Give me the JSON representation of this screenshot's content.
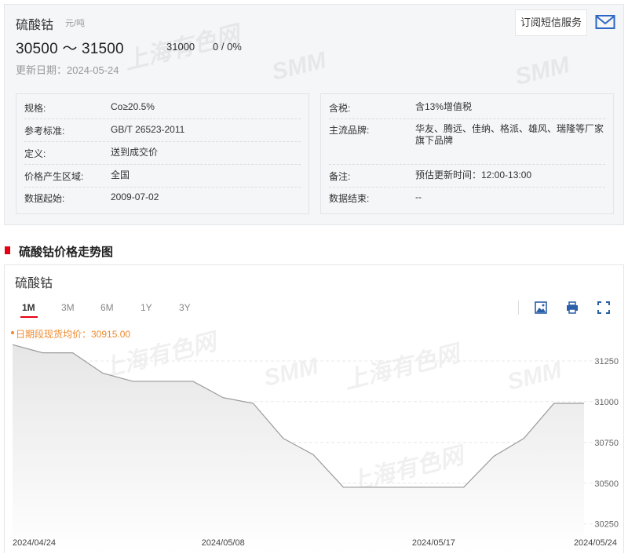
{
  "product": {
    "name": "硫酸钴",
    "unit": "元/吨",
    "price_range": "30500 ～ 31500",
    "avg_price": "31000",
    "change": "0 / 0%",
    "update_date": "更新日期：2024-05-24"
  },
  "actions": {
    "sms_subscribe": "订阅短信服务"
  },
  "specs_left": [
    {
      "label": "规格:",
      "value": "Co≥20.5%"
    },
    {
      "label": "参考标准:",
      "value": "GB/T 26523-2011"
    },
    {
      "label": "定义:",
      "value": "送到成交价"
    },
    {
      "label": "价格产生区域:",
      "value": "全国"
    },
    {
      "label": "数据起始:",
      "value": "2009-07-02"
    }
  ],
  "specs_right": [
    {
      "label": "含税:",
      "value": "含13%增值税"
    },
    {
      "label": "主流品牌:",
      "value": "华友、腾远、佳纳、格派、雄风、瑞隆等厂家旗下品牌"
    },
    {
      "label": "备注:",
      "value": "预估更新时间：12:00-13:00"
    },
    {
      "label": "数据结束:",
      "value": "--"
    }
  ],
  "section": {
    "title": "硫酸钴价格走势图"
  },
  "chart_panel": {
    "title": "硫酸钴",
    "tabs": [
      "1M",
      "3M",
      "6M",
      "1Y",
      "3Y"
    ],
    "active_tab": "1M",
    "legend": "日期段现货均价：30915.00",
    "watermark_brand": "SMM",
    "watermark_text": "上海有色网",
    "icons": [
      "image-download-icon",
      "print-icon",
      "fullscreen-icon"
    ]
  },
  "colors": {
    "accent": "#e60012",
    "legend": "#f08a2c",
    "line": "#9a9a9a",
    "area_top": "#e6e6e6",
    "area_bottom": "#ffffff"
  },
  "chart_data": {
    "type": "area",
    "title": "",
    "x": [
      "2024/04/24",
      "2024/04/25",
      "2024/04/26",
      "2024/04/29",
      "2024/04/30",
      "2024/05/06",
      "2024/05/07",
      "2024/05/08",
      "2024/05/09",
      "2024/05/10",
      "2024/05/13",
      "2024/05/14",
      "2024/05/15",
      "2024/05/16",
      "2024/05/17",
      "2024/05/20",
      "2024/05/21",
      "2024/05/22",
      "2024/05/23",
      "2024/05/24"
    ],
    "series": [
      {
        "name": "",
        "values": [
          31350,
          31300,
          31300,
          31175,
          31125,
          31125,
          31125,
          31025,
          30990,
          30775,
          30675,
          30475,
          30475,
          30475,
          30475,
          30475,
          30665,
          30775,
          30990,
          30990
        ]
      }
    ],
    "x_tick_labels": [
      "2024/04/24",
      "2024/05/08",
      "2024/05/17",
      "2024/05/24"
    ],
    "y_ticks": [
      30250,
      30500,
      30750,
      31000,
      31250
    ],
    "ylim": [
      30210,
      31380
    ],
    "y_axis_position": "right",
    "grid": "horizontal-dashed",
    "legend_placement": "top-left"
  }
}
